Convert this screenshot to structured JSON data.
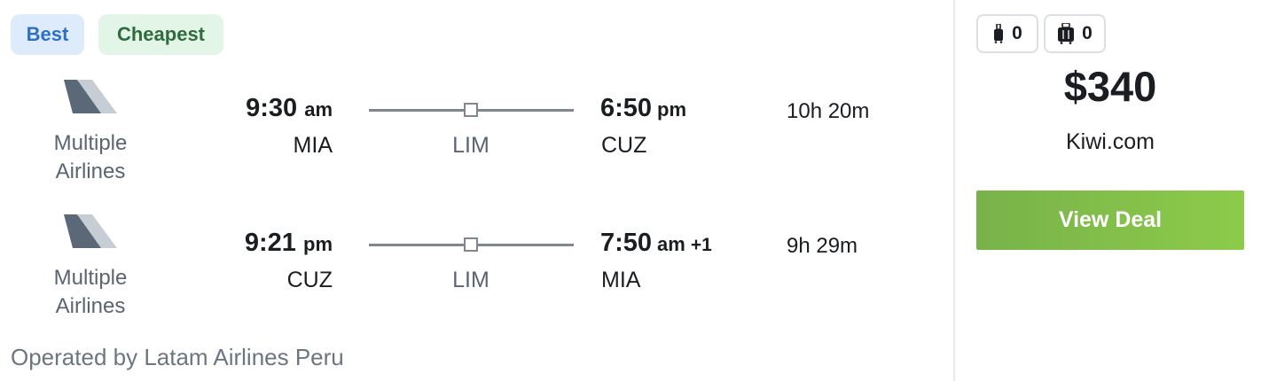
{
  "tags": {
    "best": "Best",
    "cheapest": "Cheapest"
  },
  "legs": [
    {
      "airline": "Multiple Airlines",
      "depart_time": "9:30",
      "depart_ampm": "am",
      "depart_code": "MIA",
      "stop_code": "LIM",
      "arrive_time": "6:50",
      "arrive_ampm": "pm",
      "arrive_plus": "",
      "arrive_code": "CUZ",
      "duration": "10h 20m"
    },
    {
      "airline": "Multiple Airlines",
      "depart_time": "9:21",
      "depart_ampm": "pm",
      "depart_code": "CUZ",
      "stop_code": "LIM",
      "arrive_time": "7:50",
      "arrive_ampm": "am",
      "arrive_plus": "+1",
      "arrive_code": "MIA",
      "duration": "9h 29m"
    }
  ],
  "operated_by": "Operated by Latam Airlines Peru",
  "bags": {
    "carry_on_count": "0",
    "checked_count": "0",
    "carry_on_icon": "carry-on-bag-icon",
    "checked_icon": "checked-bag-icon"
  },
  "price": "$340",
  "provider": "Kiwi.com",
  "deal_button": "View Deal",
  "colors": {
    "accent_green": "#8dcb4a",
    "best_tag": "#deebfa",
    "cheapest_tag": "#e2f5e6"
  }
}
